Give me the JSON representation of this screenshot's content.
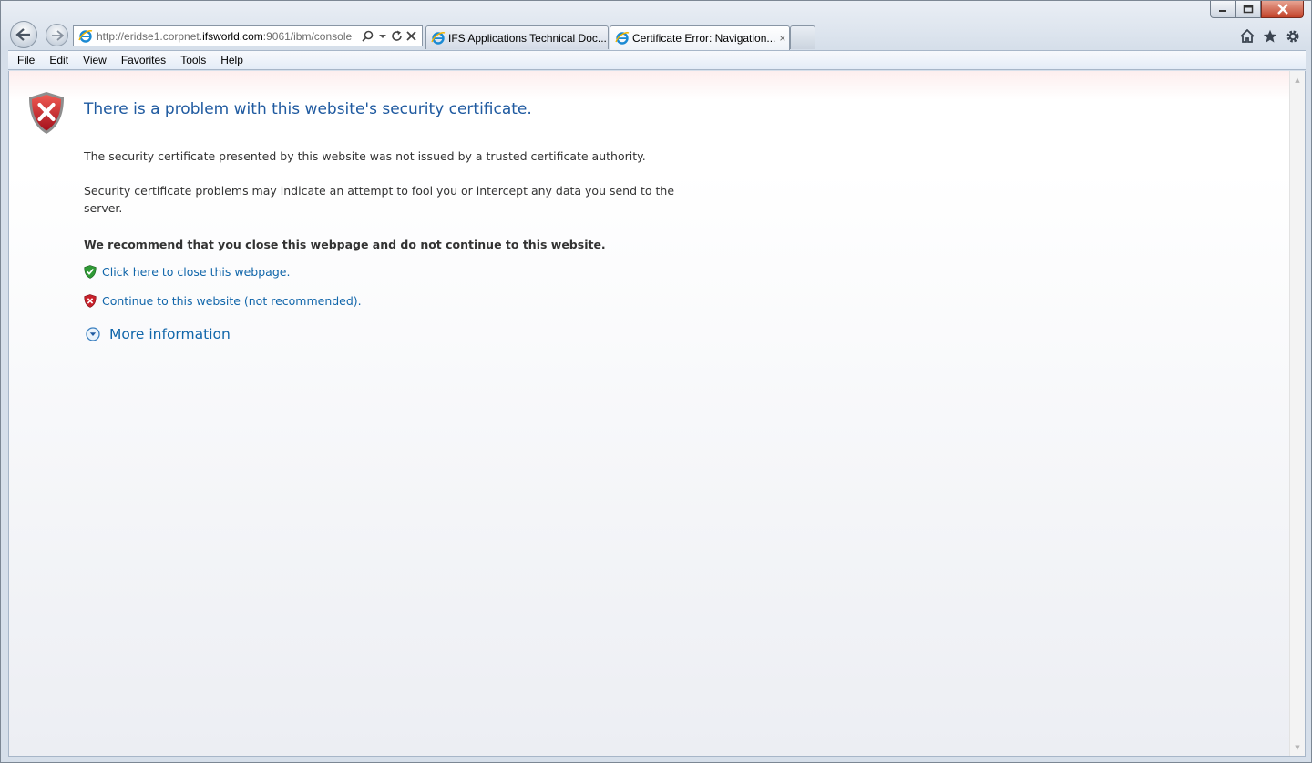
{
  "window": {
    "caption_buttons": [
      "minimize-icon",
      "maximize-icon",
      "close-icon"
    ]
  },
  "nav": {
    "back_icon": "back-arrow-icon",
    "forward_icon": "forward-arrow-icon"
  },
  "address": {
    "url_prefix": "http://eridse1.corpnet.",
    "url_host": "ifsworld.com",
    "url_suffix": ":9061/ibm/console"
  },
  "tabs": [
    {
      "label": "IFS Applications Technical Doc...",
      "active": false
    },
    {
      "label": "Certificate Error: Navigation...",
      "active": true,
      "close": "×"
    }
  ],
  "menu": [
    "File",
    "Edit",
    "View",
    "Favorites",
    "Tools",
    "Help"
  ],
  "page": {
    "title": "There is a problem with this website's security certificate.",
    "para1": "The security certificate presented by this website was not issued by a trusted certificate authority.",
    "para2": "Security certificate problems may indicate an attempt to fool you or intercept any data you send to the server.",
    "recommend": "We recommend that you close this webpage and do not continue to this website.",
    "close_link": "Click here to close this webpage.",
    "continue_link": "Continue to this website (not recommended).",
    "more_info": "More information"
  },
  "colors": {
    "title": "#1f5aa0",
    "link": "#1166aa",
    "shield_red": "#c8202a",
    "shield_green": "#2f9a35"
  }
}
